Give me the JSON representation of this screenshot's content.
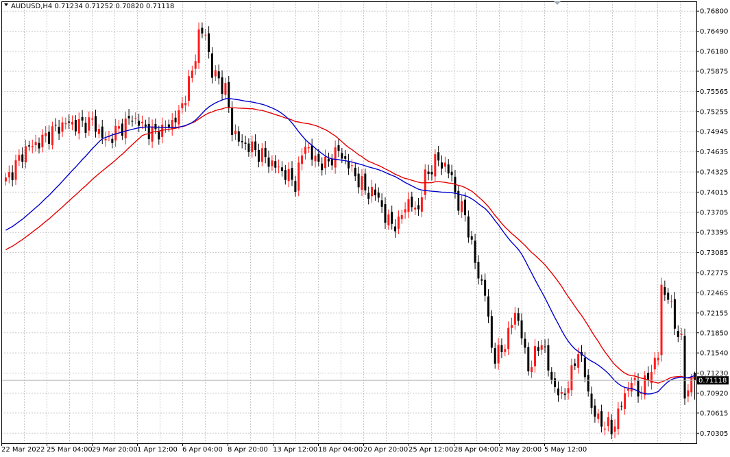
{
  "header": {
    "symbol_line": "AUDUSD,H4  0.71234 0.71252 0.70820 0.71118"
  },
  "current_price_label": "0.71118",
  "colors": {
    "bull": "#ff1a1a",
    "bear": "#000000",
    "ma_fast": "#0000cc",
    "ma_slow": "#e60000",
    "background": "#ffffff",
    "grid": "#c8c8c8",
    "price_tag_bg": "#000000"
  },
  "chart_data": {
    "type": "candlestick",
    "symbol": "AUDUSD",
    "timeframe": "H4",
    "ohlc_last": {
      "open": 0.71234,
      "high": 0.71252,
      "low": 0.7082,
      "close": 0.71118
    },
    "ylim": [
      0.7015,
      0.7695
    ],
    "y_ticks": [
      "0.76800",
      "0.76490",
      "0.76180",
      "0.75875",
      "0.75565",
      "0.75255",
      "0.74945",
      "0.74635",
      "0.74325",
      "0.74015",
      "0.73705",
      "0.73395",
      "0.73085",
      "0.72775",
      "0.72465",
      "0.72155",
      "0.71850",
      "0.71540",
      "0.71230",
      "0.70920",
      "0.70615",
      "0.70305"
    ],
    "x_labels": [
      "22 Mar 2022",
      "25 Mar 04:00",
      "29 Mar 20:00",
      "1 Apr 12:00",
      "6 Apr 04:00",
      "8 Apr 20:00",
      "13 Apr 12:00",
      "18 Apr 04:00",
      "20 Apr 20:00",
      "25 Apr 12:00",
      "28 Apr 04:00",
      "2 May 20:00",
      "5 May 12:00"
    ],
    "grid": true,
    "series": [
      {
        "type": "candles",
        "anchors": [
          [
            0,
            0.7418
          ],
          [
            6,
            0.7468
          ],
          [
            10,
            0.7478
          ],
          [
            14,
            0.7495
          ],
          [
            18,
            0.7508
          ],
          [
            22,
            0.7505
          ],
          [
            26,
            0.751
          ],
          [
            30,
            0.748
          ],
          [
            34,
            0.7498
          ],
          [
            38,
            0.7516
          ],
          [
            40,
            0.7508
          ],
          [
            44,
            0.7492
          ],
          [
            48,
            0.75
          ],
          [
            52,
            0.752
          ],
          [
            56,
            0.7585
          ],
          [
            58,
            0.7645
          ],
          [
            60,
            0.7645
          ],
          [
            62,
            0.7585
          ],
          [
            64,
            0.7575
          ],
          [
            66,
            0.7558
          ],
          [
            68,
            0.75
          ],
          [
            70,
            0.748
          ],
          [
            73,
            0.7472
          ],
          [
            76,
            0.7462
          ],
          [
            80,
            0.7445
          ],
          [
            84,
            0.743
          ],
          [
            87,
            0.7415
          ],
          [
            90,
            0.7478
          ],
          [
            92,
            0.7455
          ],
          [
            96,
            0.7443
          ],
          [
            98,
            0.7455
          ],
          [
            100,
            0.7465
          ],
          [
            104,
            0.7435
          ],
          [
            108,
            0.7405
          ],
          [
            112,
            0.7395
          ],
          [
            114,
            0.736
          ],
          [
            118,
            0.735
          ],
          [
            120,
            0.7385
          ],
          [
            124,
            0.7375
          ],
          [
            126,
            0.7425
          ],
          [
            128,
            0.744
          ],
          [
            130,
            0.7452
          ],
          [
            132,
            0.744
          ],
          [
            134,
            0.7425
          ],
          [
            136,
            0.738
          ],
          [
            138,
            0.737
          ],
          [
            140,
            0.7315
          ],
          [
            142,
            0.7275
          ],
          [
            144,
            0.7245
          ],
          [
            146,
            0.7165
          ],
          [
            147,
            0.7145
          ],
          [
            149,
            0.716
          ],
          [
            151,
            0.718
          ],
          [
            153,
            0.722
          ],
          [
            155,
            0.718
          ],
          [
            157,
            0.713
          ],
          [
            159,
            0.715
          ],
          [
            161,
            0.7175
          ],
          [
            163,
            0.713
          ],
          [
            165,
            0.71
          ],
          [
            167,
            0.7085
          ],
          [
            168,
            0.7095
          ],
          [
            170,
            0.712
          ],
          [
            172,
            0.716
          ],
          [
            174,
            0.712
          ],
          [
            176,
            0.707
          ],
          [
            178,
            0.705
          ],
          [
            180,
            0.7045
          ],
          [
            182,
            0.7035
          ],
          [
            184,
            0.706
          ],
          [
            186,
            0.709
          ],
          [
            188,
            0.7112
          ],
          [
            190,
            0.7095
          ],
          [
            192,
            0.7105
          ],
          [
            194,
            0.713
          ],
          [
            196,
            0.715
          ],
          [
            197,
            0.7255
          ],
          [
            199,
            0.724
          ],
          [
            201,
            0.72
          ],
          [
            203,
            0.717
          ],
          [
            204,
            0.709
          ],
          [
            206,
            0.711
          ],
          [
            207,
            0.7112
          ]
        ]
      },
      {
        "name": "",
        "type": "ma_fast",
        "color": "#0000cc"
      },
      {
        "name": "",
        "type": "ma_slow",
        "color": "#e60000"
      }
    ]
  }
}
